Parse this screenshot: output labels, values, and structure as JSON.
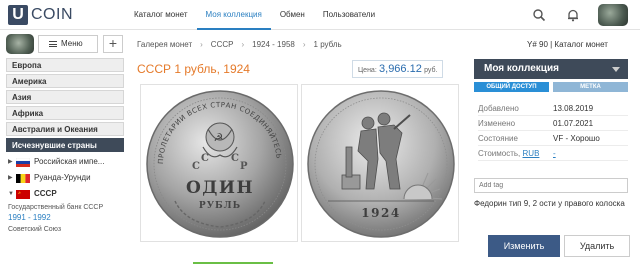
{
  "header": {
    "logo_letter": "U",
    "logo_text": "COIN",
    "nav": [
      "Каталог монет",
      "Моя коллекция",
      "Обмен",
      "Пользователи"
    ],
    "active_nav": 1
  },
  "sidebar": {
    "menu_label": "Меню",
    "plus_label": "+",
    "regions": [
      "Европа",
      "Америка",
      "Азия",
      "Африка",
      "Австралия и Океания"
    ],
    "vanished_label": "Исчезнувшие страны",
    "countries": [
      {
        "name": "Российская импе...",
        "flag_colors": [
          "#ffffff",
          "#1a3fa8",
          "#d52b1e"
        ]
      },
      {
        "name": "Руанда-Урунди",
        "flag_colors": [
          "#000000",
          "#f7d417",
          "#e1252b"
        ]
      },
      {
        "name": "СССР",
        "flag_colors": [
          "#cc0000"
        ]
      }
    ],
    "bank": "Государственный банк СССР",
    "years": "1991 - 1992",
    "soviet": "Советский Союз"
  },
  "breadcrumb": [
    "Галерея монет",
    "СССР",
    "1924 - 1958",
    "1 рубль"
  ],
  "catalog_ref": "Y# 90 | Каталог монет",
  "title": "СССР 1 рубль, 1924",
  "price": {
    "label": "Цена:",
    "value": "3,966.12",
    "currency": "руб."
  },
  "coin": {
    "obverse_text_top": "ПРОЛЕТАРИИ ВСЕХ СТРАН СОЕДИНЯЙТЕСЬ",
    "denomination": "ОДИН",
    "unit": "РУБЛЬ",
    "ussr_letters": [
      "С",
      "С",
      "С",
      "Р"
    ],
    "year": "1924"
  },
  "panel": {
    "title": "Моя коллекция",
    "badge_public": "ОБЩИЙ ДОСТУП",
    "badge_tag": "МЕТКА",
    "props": [
      {
        "k": "Добавлено",
        "v": "13.08.2019"
      },
      {
        "k": "Изменено",
        "v": "01.07.2021"
      },
      {
        "k": "Состояние",
        "v": "VF - Хорошо"
      }
    ],
    "cost_label": "Стоимость,",
    "cost_currency": "RUB",
    "cost_value": "-",
    "add_tag_placeholder": "Add tag",
    "note": "Федорин тип 9, 2 ости у правого колоска",
    "edit_label": "Изменить",
    "delete_label": "Удалить"
  },
  "colors": {
    "accent": "#2a7fc1",
    "title_orange": "#e57a2a",
    "dark_header": "#3e4a59",
    "edit_btn": "#3c5a86"
  }
}
